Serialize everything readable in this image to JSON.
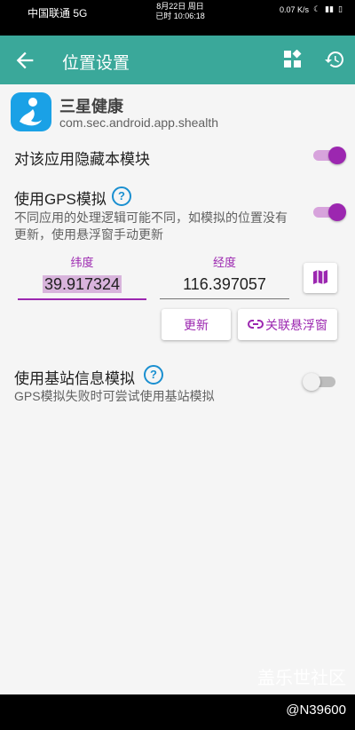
{
  "status_bar": {
    "carrier": "中国联通 5G",
    "date": "8月22日 周日",
    "time": "已时 10:06:18",
    "net_speed": "0.07 K/s",
    "battery_icon": "battery-icon"
  },
  "app_bar": {
    "title": "位置设置",
    "back_icon": "back-arrow-icon",
    "action1_icon": "widgets-icon",
    "action2_icon": "history-icon"
  },
  "app": {
    "name": "三星健康",
    "package": "com.sec.android.app.shealth",
    "icon_color": "#1aa1e6"
  },
  "hide_module": {
    "label": "对该应用隐藏本模块",
    "enabled": true
  },
  "gps": {
    "label": "使用GPS模拟",
    "description": "不同应用的处理逻辑可能不同，如模拟的位置没有更新，使用悬浮窗手动更新",
    "enabled": true
  },
  "coords": {
    "lat_label": "纬度",
    "lat_value": "39.917324",
    "lng_label": "经度",
    "lng_value": "116.397057",
    "map_icon": "map-icon"
  },
  "buttons": {
    "update": "更新",
    "float": "关联悬浮窗",
    "link_icon": "link-icon"
  },
  "cell": {
    "label": "使用基站信息模拟",
    "description": "GPS模拟失败时可尝试使用基站模拟",
    "enabled": false
  },
  "watermark": {
    "line1": "盖乐世社区",
    "line2": "@N39600"
  },
  "colors": {
    "primary": "#3aa89a",
    "accent": "#9c27b0",
    "help": "#1a8fd0"
  }
}
